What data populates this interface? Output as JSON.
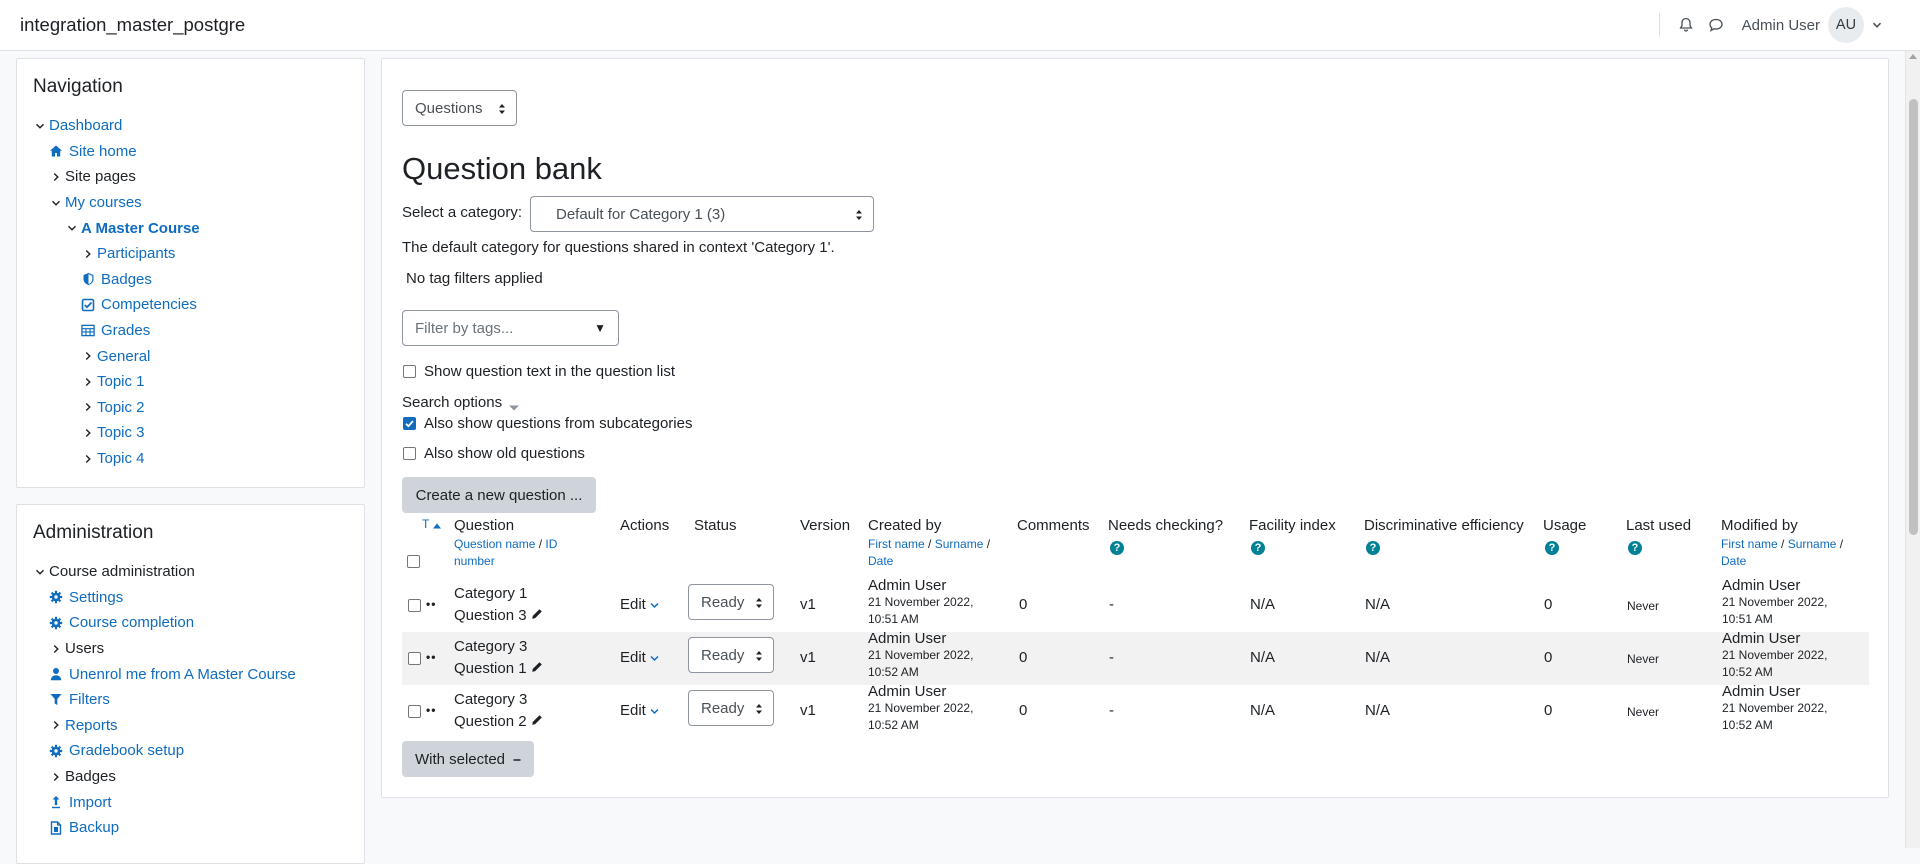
{
  "navbar": {
    "site_name": "integration_master_postgre",
    "user_name": "Admin User",
    "avatar_initials": "AU"
  },
  "navigation": {
    "title": "Navigation",
    "items": [
      {
        "label": "Dashboard",
        "icon": "chevron-down-icon"
      },
      {
        "label": "Site home",
        "icon": "home-icon"
      },
      {
        "label": "Site pages",
        "icon": "chevron-right-icon"
      },
      {
        "label": "My courses",
        "icon": "chevron-down-icon"
      },
      {
        "label": "A Master Course",
        "icon": "chevron-down-icon"
      },
      {
        "label": "Participants",
        "icon": "chevron-right-icon"
      },
      {
        "label": "Badges",
        "icon": "shield-icon"
      },
      {
        "label": "Competencies",
        "icon": "checkbox-icon"
      },
      {
        "label": "Grades",
        "icon": "table-icon"
      },
      {
        "label": "General",
        "icon": "chevron-right-icon"
      },
      {
        "label": "Topic 1",
        "icon": "chevron-right-icon"
      },
      {
        "label": "Topic 2",
        "icon": "chevron-right-icon"
      },
      {
        "label": "Topic 3",
        "icon": "chevron-right-icon"
      },
      {
        "label": "Topic 4",
        "icon": "chevron-right-icon"
      }
    ]
  },
  "administration": {
    "title": "Administration",
    "items": [
      {
        "label": "Course administration",
        "icon": "chevron-down-icon"
      },
      {
        "label": "Settings",
        "icon": "gear-icon"
      },
      {
        "label": "Course completion",
        "icon": "gear-icon"
      },
      {
        "label": "Users",
        "icon": "chevron-right-icon"
      },
      {
        "label": "Unenrol me from A Master Course",
        "icon": "user-icon"
      },
      {
        "label": "Filters",
        "icon": "filter-icon"
      },
      {
        "label": "Reports",
        "icon": "chevron-right-icon"
      },
      {
        "label": "Gradebook setup",
        "icon": "gear-icon"
      },
      {
        "label": "Badges",
        "icon": "chevron-right-icon"
      },
      {
        "label": "Import",
        "icon": "upload-icon"
      },
      {
        "label": "Backup",
        "icon": "file-icon"
      }
    ]
  },
  "main": {
    "page_select": "Questions",
    "heading": "Question bank",
    "category_label": "Select a category:",
    "category_value": "Default for Category 1 (3)",
    "category_description": "The default category for questions shared in context 'Category 1'.",
    "tag_status": "No tag filters applied",
    "filter_placeholder": "Filter by tags...",
    "show_question_text": "Show question text in the question list",
    "search_options": "Search options",
    "subcategories": "Also show questions from subcategories",
    "old_questions": "Also show old questions",
    "create_button": "Create a new question ...",
    "with_selected": "With selected"
  },
  "table": {
    "headers": {
      "type": "T",
      "question": "Question",
      "question_name": "Question name",
      "id_number": "ID number",
      "actions": "Actions",
      "status": "Status",
      "version": "Version",
      "created_by": "Created by",
      "first_name": "First name",
      "surname": "Surname",
      "date": "Date",
      "comments": "Comments",
      "needs_checking": "Needs checking?",
      "facility_index": "Facility index",
      "discriminative_efficiency": "Discriminative efficiency",
      "usage": "Usage",
      "last_used": "Last used",
      "modified_by": "Modified by"
    },
    "rows": [
      {
        "name": "Category 1 Question 3",
        "action": "Edit",
        "status": "Ready",
        "version": "v1",
        "created_name": "Admin User",
        "created_date": "21 November 2022,",
        "created_time": "10:51 AM",
        "comments": "0",
        "needs_checking": "-",
        "facility": "N/A",
        "discrimination": "N/A",
        "usage": "0",
        "last_used": "Never",
        "modified_name": "Admin User",
        "modified_date": "21 November 2022,",
        "modified_time": "10:51 AM"
      },
      {
        "name": "Category 3 Question 1",
        "action": "Edit",
        "status": "Ready",
        "version": "v1",
        "created_name": "Admin User",
        "created_date": "21 November 2022,",
        "created_time": "10:52 AM",
        "comments": "0",
        "needs_checking": "-",
        "facility": "N/A",
        "discrimination": "N/A",
        "usage": "0",
        "last_used": "Never",
        "modified_name": "Admin User",
        "modified_date": "21 November 2022,",
        "modified_time": "10:52 AM"
      },
      {
        "name": "Category 3 Question 2",
        "action": "Edit",
        "status": "Ready",
        "version": "v1",
        "created_name": "Admin User",
        "created_date": "21 November 2022,",
        "created_time": "10:52 AM",
        "comments": "0",
        "needs_checking": "-",
        "facility": "N/A",
        "discrimination": "N/A",
        "usage": "0",
        "last_used": "Never",
        "modified_name": "Admin User",
        "modified_date": "21 November 2022,",
        "modified_time": "10:52 AM"
      }
    ]
  },
  "colors": {
    "link": "#0f6cbf",
    "help_icon": "#008196",
    "button_grey": "#ced4da"
  }
}
